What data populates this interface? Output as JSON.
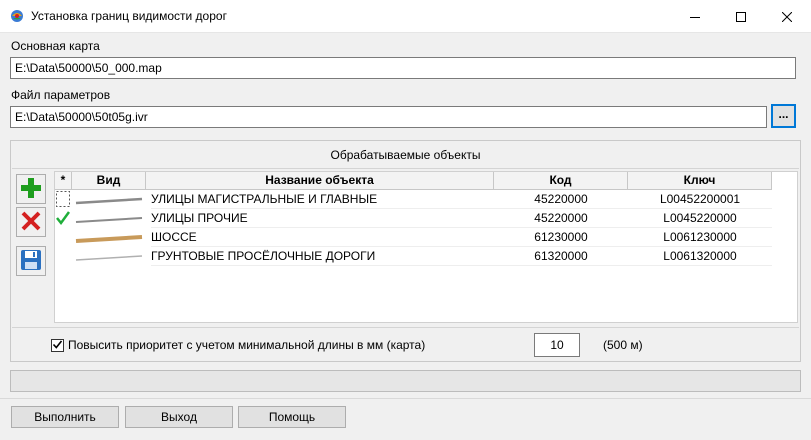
{
  "window": {
    "title": "Установка границ видимости дорог",
    "icons": [
      "app-icon",
      "minimize-icon",
      "maximize-icon",
      "close-icon"
    ]
  },
  "main_map": {
    "label": "Основная карта",
    "value": "E:\\Data\\50000\\50_000.map"
  },
  "params_file": {
    "label": "Файл параметров",
    "value": "E:\\Data\\50000\\50t05g.ivr",
    "browse_label": "..."
  },
  "objects": {
    "title": "Обрабатываемые объекты",
    "toolbar_icons": [
      "add-icon",
      "delete-icon",
      "save-icon"
    ],
    "columns": {
      "marker": "*",
      "view": "Вид",
      "name": "Название объекта",
      "code": "Код",
      "key": "Ключ"
    },
    "rows": [
      {
        "name": "УЛИЦЫ МАГИСТРАЛЬНЫЕ И ГЛАВНЫЕ",
        "code": "45220000",
        "key": "L00452200001",
        "line_color": "#8a8a8a",
        "marker": "dashed-box"
      },
      {
        "name": "УЛИЦЫ ПРОЧИЕ",
        "code": "45220000",
        "key": "L0045220000",
        "line_color": "#8a8a8a",
        "marker": "check-icon"
      },
      {
        "name": "ШОССЕ",
        "code": "61230000",
        "key": "L0061230000",
        "line_color": "#c89a5a",
        "marker": ""
      },
      {
        "name": "ГРУНТОВЫЕ ПРОСЁЛОЧНЫЕ ДОРОГИ",
        "code": "61320000",
        "key": "L0061320000",
        "line_color": "#b0b0b0",
        "marker": ""
      }
    ]
  },
  "priority": {
    "checked": true,
    "label": "Повысить приоритет с учетом минимальной длины в мм (карта)",
    "value": "10",
    "scale_text": "(500 м)"
  },
  "progress": {
    "fraction": 0
  },
  "buttons": {
    "run": "Выполнить",
    "exit": "Выход",
    "help": "Помощь"
  },
  "colors": {
    "accent": "#0078d7",
    "add": "#1e9e1e",
    "delete": "#d42020",
    "save": "#2a70c0",
    "check": "#1fae3a"
  }
}
